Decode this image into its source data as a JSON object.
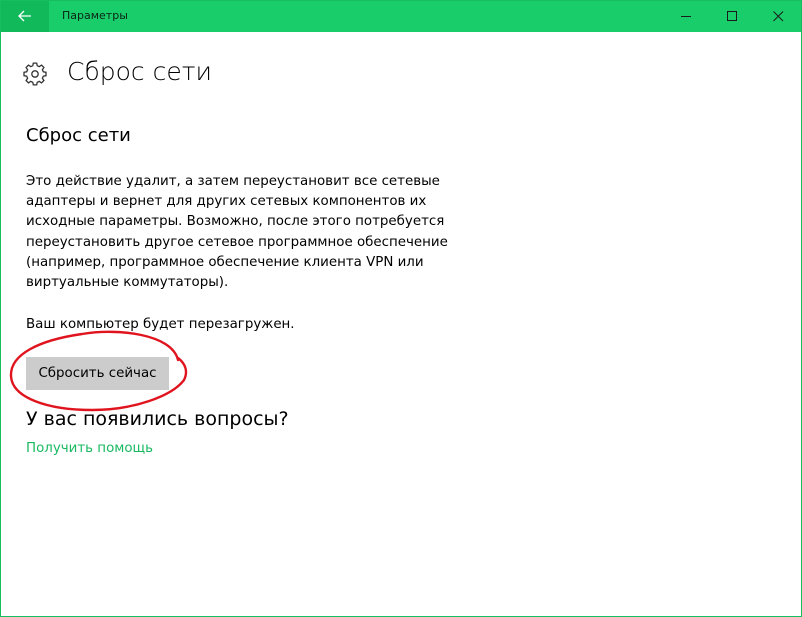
{
  "window": {
    "title": "Параметры",
    "accent_color": "#19cd6a",
    "back_icon": "arrow-left-icon",
    "controls": {
      "minimize_icon": "minimize-icon",
      "maximize_icon": "maximize-icon",
      "close_icon": "close-icon"
    }
  },
  "page": {
    "icon": "gear-icon",
    "title": "Сброс сети"
  },
  "section": {
    "title": "Сброс сети",
    "description_lines": [
      "Это действие удалит, а затем переустановит все сетевые",
      "адаптеры и вернет для других сетевых компонентов их",
      "исходные параметры. Возможно, после этого потребуется",
      "переустановить другое сетевое программное обеспечение",
      "(например, программное обеспечение клиента VPN или",
      "виртуальные коммутаторы)."
    ],
    "restart_note": "Ваш компьютер будет перезагружен.",
    "reset_button_label": "Сбросить сейчас",
    "annotation_color": "#e0141e"
  },
  "help": {
    "title": "У вас появились вопросы?",
    "link_label": "Получить помощь",
    "link_color": "#19b962"
  }
}
